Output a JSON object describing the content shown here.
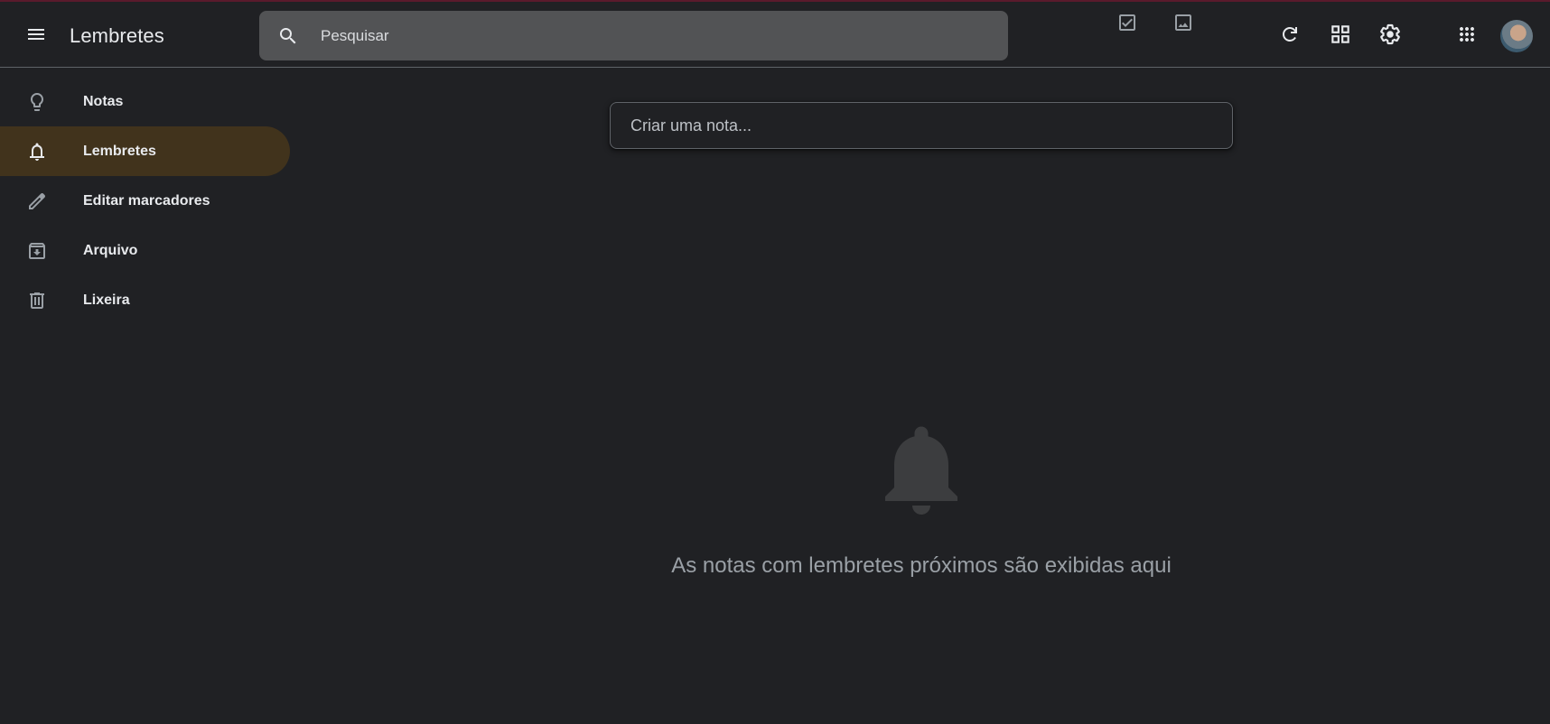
{
  "header": {
    "app_title": "Lembretes",
    "search_placeholder": "Pesquisar",
    "icons": [
      "menu-icon",
      "search-icon",
      "refresh-icon",
      "grid-view-icon",
      "settings-icon",
      "apps-icon"
    ]
  },
  "sidebar": {
    "items": [
      {
        "label": "Notas",
        "icon": "lightbulb-icon",
        "active": false
      },
      {
        "label": "Lembretes",
        "icon": "bell-icon",
        "active": true
      },
      {
        "label": "Editar marcadores",
        "icon": "pencil-icon",
        "active": false
      },
      {
        "label": "Arquivo",
        "icon": "archive-icon",
        "active": false
      },
      {
        "label": "Lixeira",
        "icon": "trash-icon",
        "active": false
      }
    ]
  },
  "take_note": {
    "placeholder": "Criar uma nota..."
  },
  "empty_state": {
    "icon": "bell-icon",
    "message": "As notas com lembretes próximos são exibidas aqui"
  },
  "colors": {
    "background": "#202124",
    "active_nav": "#41331c",
    "search_bg": "#525355"
  }
}
